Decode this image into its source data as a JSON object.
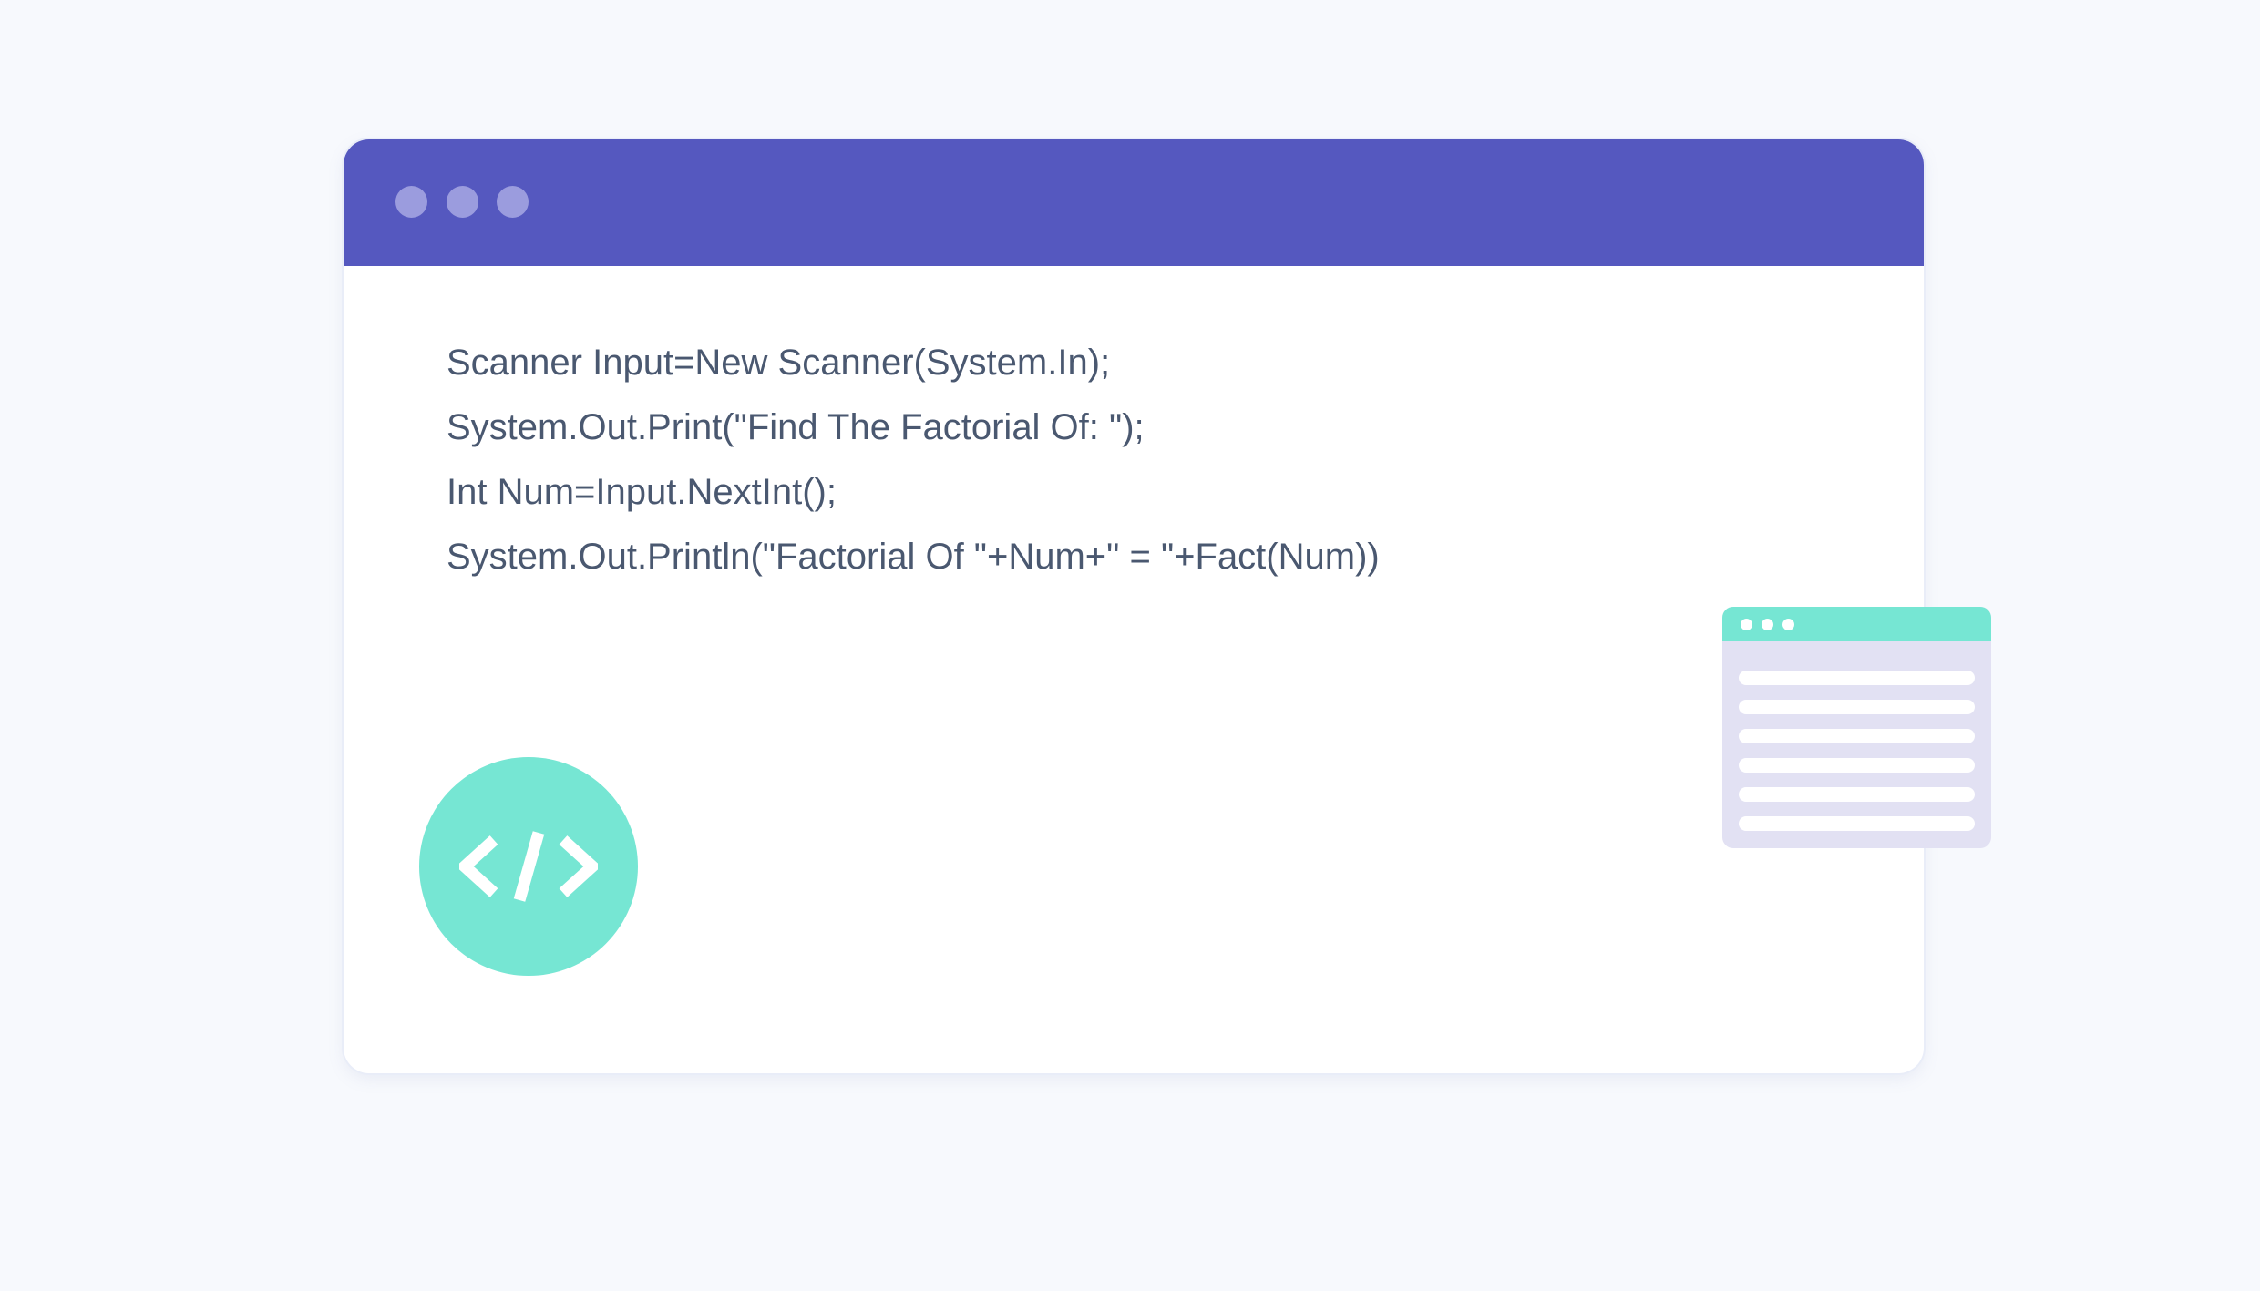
{
  "colors": {
    "background": "#f7f9fd",
    "titlebar": "#5558bf",
    "titlebar_dot": "#9b9cde",
    "code_text": "#4a5870",
    "accent_teal": "#76e6d3",
    "panel_lavender": "#e2e1f3",
    "white": "#ffffff"
  },
  "editor_window": {
    "code_lines": [
      "Scanner Input=New Scanner(System.In);",
      "System.Out.Print(\"Find The Factorial Of: \");",
      "Int Num=Input.NextInt();",
      "System.Out.Println(\"Factorial Of \"+Num+\" = \"+Fact(Num))"
    ]
  },
  "badge": {
    "icon": "code-brackets-icon"
  },
  "mini_window": {
    "icon": "mini-browser-window"
  }
}
